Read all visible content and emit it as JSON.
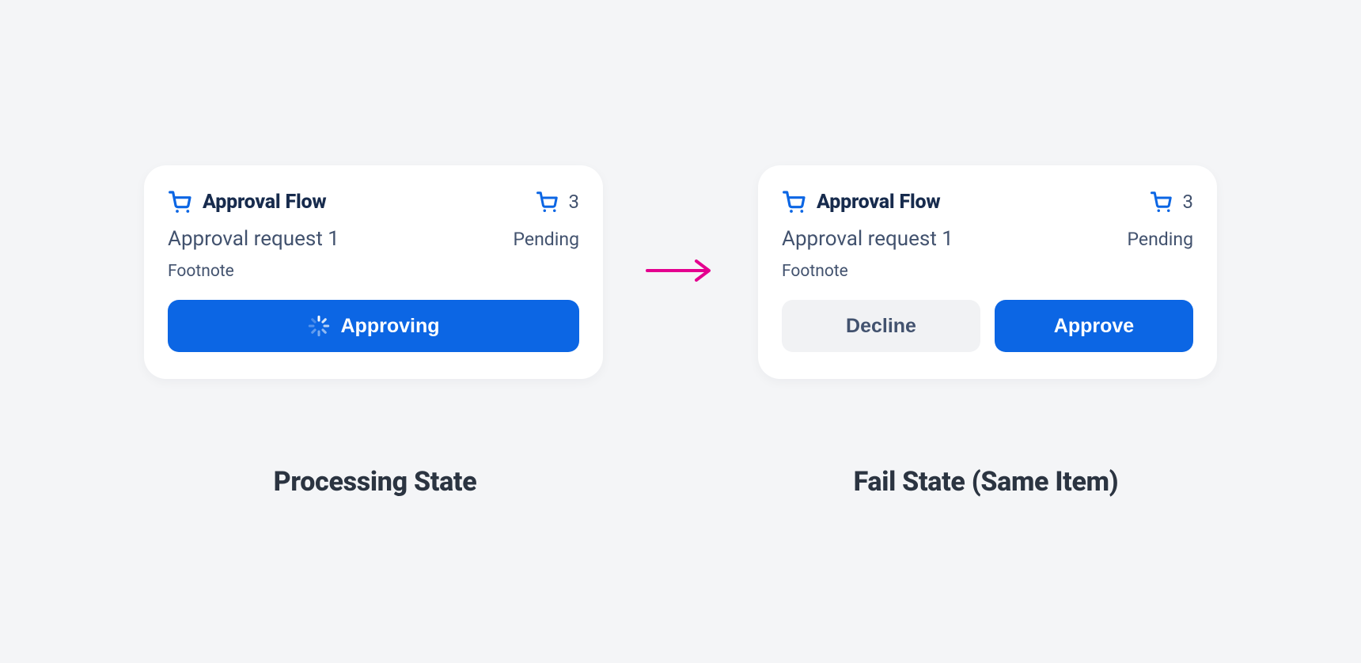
{
  "colors": {
    "primary": "#0c66e4",
    "text_dark": "#172b4d",
    "text_muted": "#42526e",
    "accent_arrow": "#e4008f",
    "bg": "#f4f5f7",
    "card_bg": "#ffffff",
    "secondary_btn_bg": "#f1f2f4"
  },
  "left": {
    "title": "Approval Flow",
    "count": "3",
    "subtitle": "Approval request 1",
    "status": "Pending",
    "footnote": "Footnote",
    "button_label": "Approving",
    "caption": "Processing State"
  },
  "right": {
    "title": "Approval Flow",
    "count": "3",
    "subtitle": "Approval request 1",
    "status": "Pending",
    "footnote": "Footnote",
    "decline_label": "Decline",
    "approve_label": "Approve",
    "caption": "Fail State (Same Item)"
  }
}
